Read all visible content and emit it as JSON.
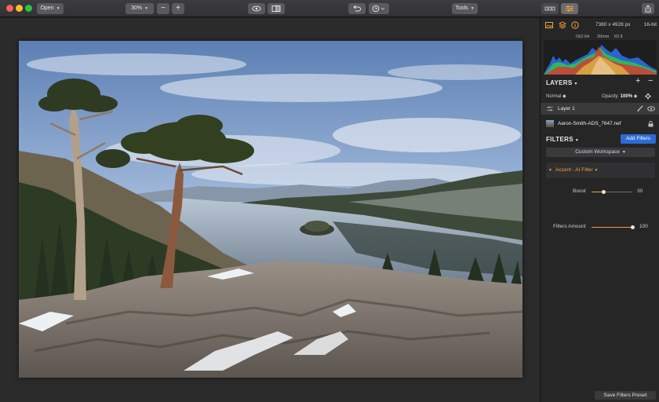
{
  "toolbar": {
    "open_label": "Open",
    "zoom_value": "30%",
    "zoom_out": "−",
    "zoom_in": "+",
    "tools_label": "Tools"
  },
  "image_info": {
    "dimensions": "7380 x 4928 px",
    "bit_depth": "16-bit",
    "iso": "ISO 64",
    "focal": "20mm",
    "aperture": "f/2.5"
  },
  "layers": {
    "title": "LAYERS",
    "add": "+",
    "remove": "−",
    "blend_mode": "Normal",
    "opacity_label": "Opacity:",
    "opacity_value": "100%",
    "layer_name": "Layer 1",
    "file_name": "Aaron-Smith-ADS_7647.nef"
  },
  "filters": {
    "title": "FILTERS",
    "add_filters_label": "Add Filters",
    "workspace_label": "Custom Workspace",
    "accent_title": "Accent - AI Filter",
    "boost_label": "Boost",
    "boost_value": "30",
    "boost_fraction": 0.3,
    "amount_label": "Filters Amount",
    "amount_value": "100",
    "amount_fraction": 1.0,
    "save_preset_label": "Save Filters Preset"
  },
  "colors": {
    "accent": "#f0a13a",
    "button_blue": "#2d6bd6"
  },
  "icons": [
    "traffic-lights",
    "eye-icon",
    "compare-icon",
    "undo-icon",
    "history-icon",
    "sliders-icon",
    "share-icon",
    "info-icon",
    "layers-icon",
    "gear-icon",
    "brush-icon",
    "lock-icon"
  ]
}
